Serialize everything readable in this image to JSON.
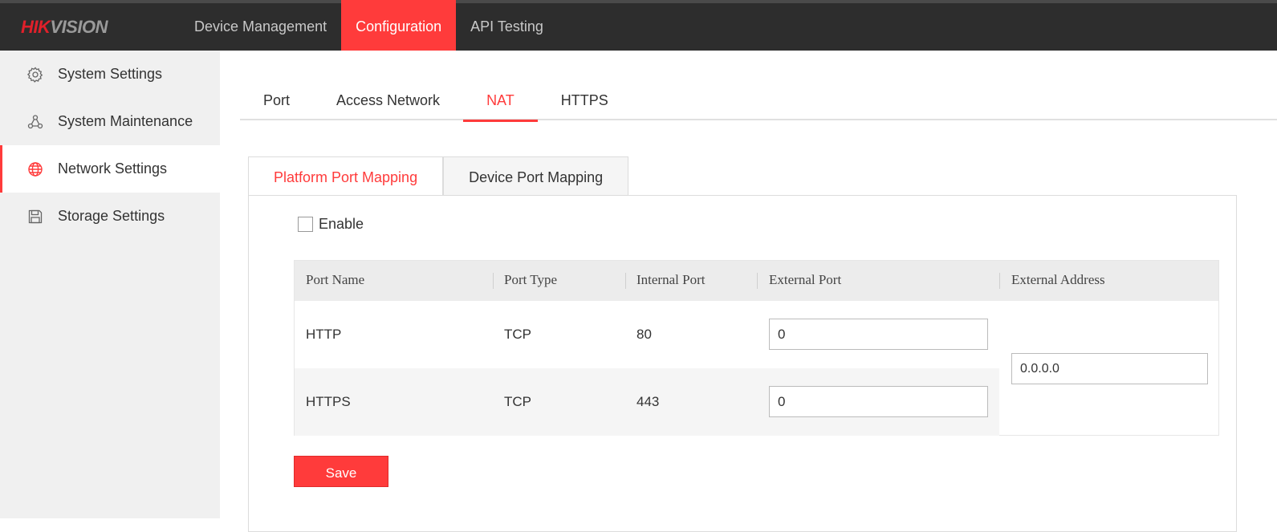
{
  "header": {
    "logo_part1": "HIK",
    "logo_part2": "VISION",
    "nav": [
      {
        "label": "Device Management",
        "active": false
      },
      {
        "label": "Configuration",
        "active": true
      },
      {
        "label": "API Testing",
        "active": false
      }
    ]
  },
  "sidebar": {
    "items": [
      {
        "label": "System Settings",
        "icon": "gear-icon",
        "active": false
      },
      {
        "label": "System Maintenance",
        "icon": "maintenance-icon",
        "active": false
      },
      {
        "label": "Network Settings",
        "icon": "globe-icon",
        "active": true
      },
      {
        "label": "Storage Settings",
        "icon": "save-disk-icon",
        "active": false
      }
    ]
  },
  "tabs": [
    {
      "label": "Port",
      "active": false
    },
    {
      "label": "Access Network",
      "active": false
    },
    {
      "label": "NAT",
      "active": true
    },
    {
      "label": "HTTPS",
      "active": false
    }
  ],
  "subtabs": [
    {
      "label": "Platform Port Mapping",
      "active": true
    },
    {
      "label": "Device Port Mapping",
      "active": false
    }
  ],
  "enable": {
    "label": "Enable",
    "checked": false
  },
  "table": {
    "headers": [
      "Port Name",
      "Port Type",
      "Internal Port",
      "External Port",
      "External Address"
    ],
    "rows": [
      {
        "name": "HTTP",
        "type": "TCP",
        "internal": "80",
        "external": "0"
      },
      {
        "name": "HTTPS",
        "type": "TCP",
        "internal": "443",
        "external": "0"
      }
    ],
    "external_address": "0.0.0.0"
  },
  "save_label": "Save",
  "colors": {
    "accent": "#ff3b3b",
    "topbar": "#2d2d2d",
    "sidebar": "#f0f0f0"
  }
}
